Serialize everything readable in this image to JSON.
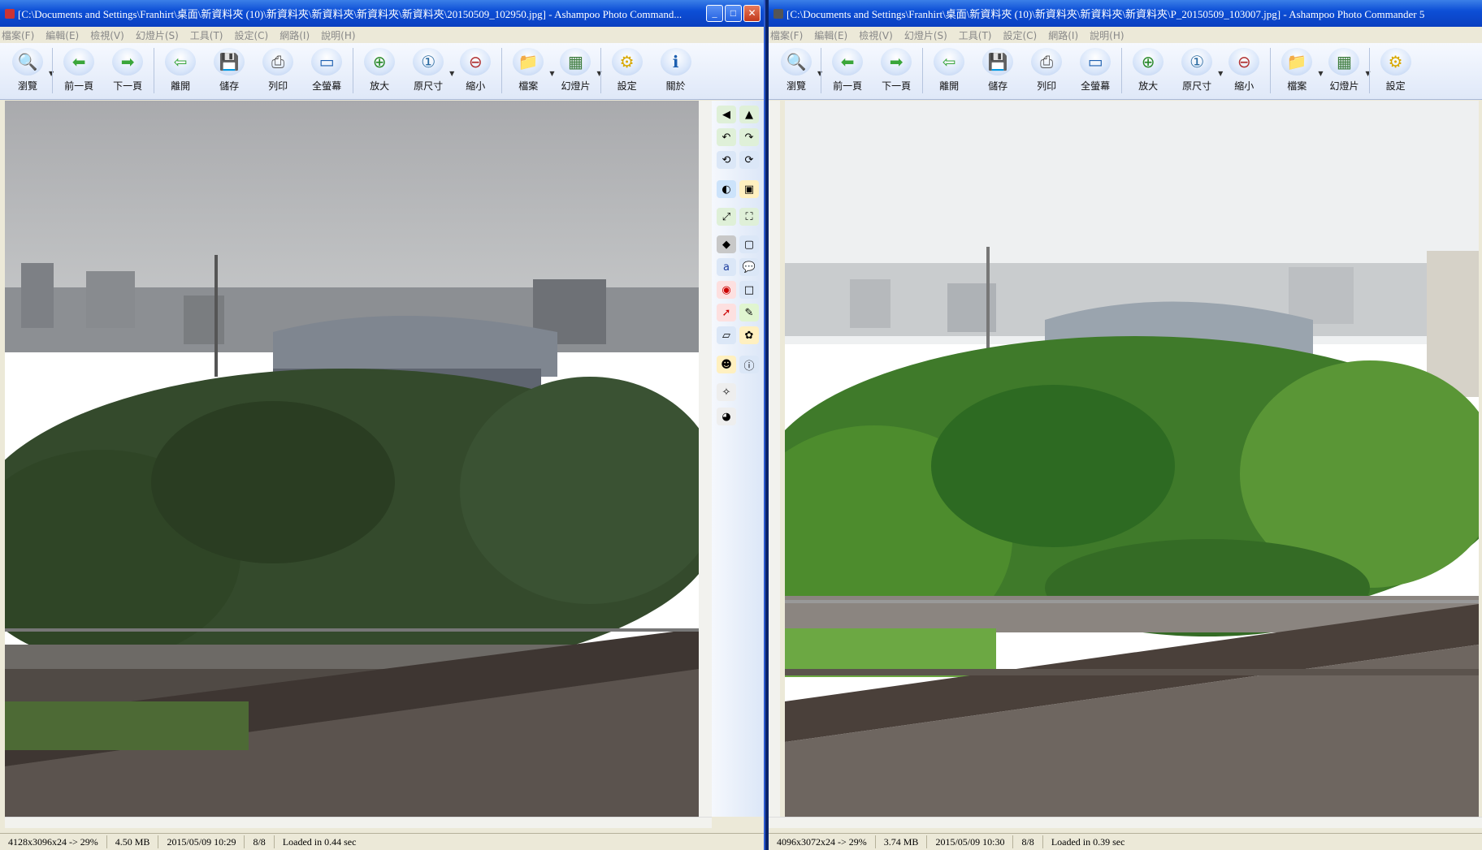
{
  "left_window": {
    "title": "[C:\\Documents and Settings\\Franhirt\\桌面\\新資料夾 (10)\\新資料夾\\新資料夾\\新資料夾\\新資料夾\\20150509_102950.jpg] - Ashampoo Photo Command...",
    "menu": [
      "檔案(F)",
      "編輯(E)",
      "檢視(V)",
      "幻燈片(S)",
      "工具(T)",
      "設定(C)",
      "網路(I)",
      "說明(H)"
    ],
    "toolbar": [
      {
        "label": "瀏覽",
        "icon": "browse-icon"
      },
      {
        "label": "前一頁",
        "icon": "arrow-left-icon"
      },
      {
        "label": "下一頁",
        "icon": "arrow-right-icon"
      },
      {
        "label": "離開",
        "icon": "exit-icon"
      },
      {
        "label": "儲存",
        "icon": "save-icon"
      },
      {
        "label": "列印",
        "icon": "print-icon"
      },
      {
        "label": "全螢幕",
        "icon": "fullscreen-icon"
      },
      {
        "label": "放大",
        "icon": "zoom-in-icon"
      },
      {
        "label": "原尺寸",
        "icon": "original-size-icon"
      },
      {
        "label": "縮小",
        "icon": "zoom-out-icon"
      },
      {
        "label": "檔案",
        "icon": "file-icon"
      },
      {
        "label": "幻燈片",
        "icon": "slideshow-icon"
      },
      {
        "label": "設定",
        "icon": "settings-icon"
      },
      {
        "label": "關於",
        "icon": "info-icon"
      }
    ],
    "status": {
      "dimensions": "4128x3096x24 -> 29%",
      "size": "4.50 MB",
      "date": "2015/05/09 10:29",
      "index": "8/8",
      "load": "Loaded in 0.44 sec"
    }
  },
  "right_window": {
    "title": "[C:\\Documents and Settings\\Franhirt\\桌面\\新資料夾 (10)\\新資料夾\\新資料夾\\新資料夾\\P_20150509_103007.jpg] - Ashampoo Photo Commander 5",
    "menu": [
      "檔案(F)",
      "編輯(E)",
      "檢視(V)",
      "幻燈片(S)",
      "工具(T)",
      "設定(C)",
      "網路(I)",
      "說明(H)"
    ],
    "toolbar": [
      {
        "label": "瀏覽",
        "icon": "browse-icon"
      },
      {
        "label": "前一頁",
        "icon": "arrow-left-icon"
      },
      {
        "label": "下一頁",
        "icon": "arrow-right-icon"
      },
      {
        "label": "離開",
        "icon": "exit-icon"
      },
      {
        "label": "儲存",
        "icon": "save-icon"
      },
      {
        "label": "列印",
        "icon": "print-icon"
      },
      {
        "label": "全螢幕",
        "icon": "fullscreen-icon"
      },
      {
        "label": "放大",
        "icon": "zoom-in-icon"
      },
      {
        "label": "原尺寸",
        "icon": "original-size-icon"
      },
      {
        "label": "縮小",
        "icon": "zoom-out-icon"
      },
      {
        "label": "檔案",
        "icon": "file-icon"
      },
      {
        "label": "幻燈片",
        "icon": "slideshow-icon"
      },
      {
        "label": "設定",
        "icon": "settings-icon"
      }
    ],
    "status": {
      "dimensions": "4096x3072x24 -> 29%",
      "size": "3.74 MB",
      "date": "2015/05/09 10:30",
      "index": "8/8",
      "load": "Loaded in 0.39 sec"
    }
  },
  "window_buttons": {
    "minimize": "_",
    "maximize": "□",
    "close": "✕"
  },
  "colors": {
    "titlebar": "#0d4fd6",
    "toolbar": "#dfe8f8",
    "window": "#ece9d8"
  }
}
